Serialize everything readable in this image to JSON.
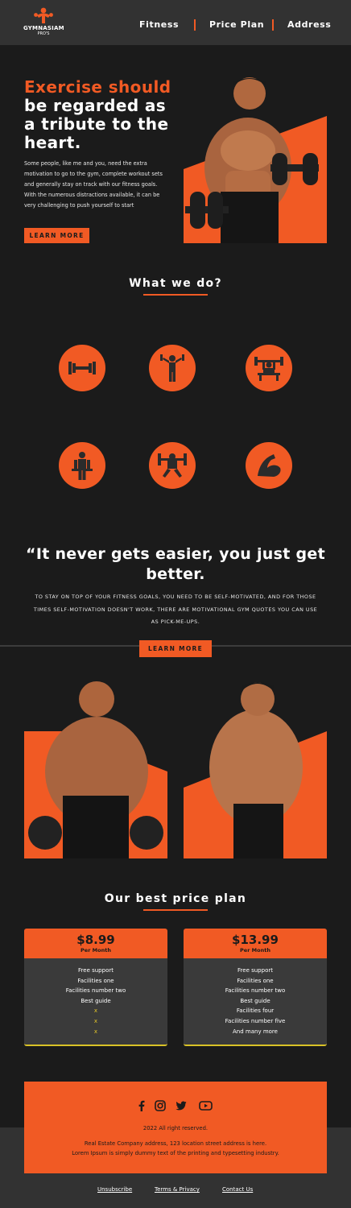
{
  "header": {
    "logo_line1": "GYMNASIAM",
    "logo_line2": "PRO'S",
    "nav": [
      "Fitness",
      "Price Plan",
      "Address"
    ]
  },
  "hero": {
    "headline_accent": "Exercise should",
    "headline_rest": [
      "be regarded as",
      "a tribute to the",
      "heart."
    ],
    "body": "Some people, like me and you, need the extra motivation to go to the gym, complete workout sets and generally stay on track with our fitness goals. With the numerous distractions available, it can be very challenging to push yourself to start",
    "button": "LEARN MORE"
  },
  "services": {
    "title": "What we do?",
    "icons": [
      "dumbbell-icon",
      "person-dumbbells-icon",
      "bench-press-icon",
      "trainer-dumbbells-icon",
      "squat-barbell-icon",
      "flexed-arm-icon"
    ]
  },
  "quote": {
    "text": "“It never gets easier, you just get better.",
    "sub": "To stay on top of your fitness goals, you need to be self-motivated, and for those times self-motivation doesn't work, there are motivational gym quotes you can use as pick-me-ups.",
    "button": "LEARN MORE"
  },
  "pricing": {
    "title": "Our best price plan",
    "plans": [
      {
        "price": "$8.99",
        "period": "Per Month",
        "features": [
          "Free support",
          "Facilities one",
          "Facilities number two",
          "Best guide",
          "x",
          "x",
          "x"
        ]
      },
      {
        "price": "$13.99",
        "period": "Per Month",
        "features": [
          "Free support",
          "Facilities one",
          "Facilities number two",
          "Best guide",
          "Facilities four",
          "Facilities number five",
          "And many more"
        ]
      }
    ]
  },
  "footer": {
    "social": [
      "facebook-icon",
      "instagram-icon",
      "twitter-icon",
      "youtube-icon"
    ],
    "copyright": "2022 All right reserved.",
    "address": "Real Estate Company address, 123 location street address is here.",
    "lorem": "Lorem Ipsum is simply dummy text of the printing and typesetting industry.",
    "links": [
      "Unsubscribe",
      "Terms & Privacy",
      "Contact Us"
    ]
  },
  "colors": {
    "accent": "#f15a24",
    "background": "#1b1b1b",
    "header": "#323232",
    "card": "#3a3a3a",
    "highlight": "#e2c42a"
  }
}
